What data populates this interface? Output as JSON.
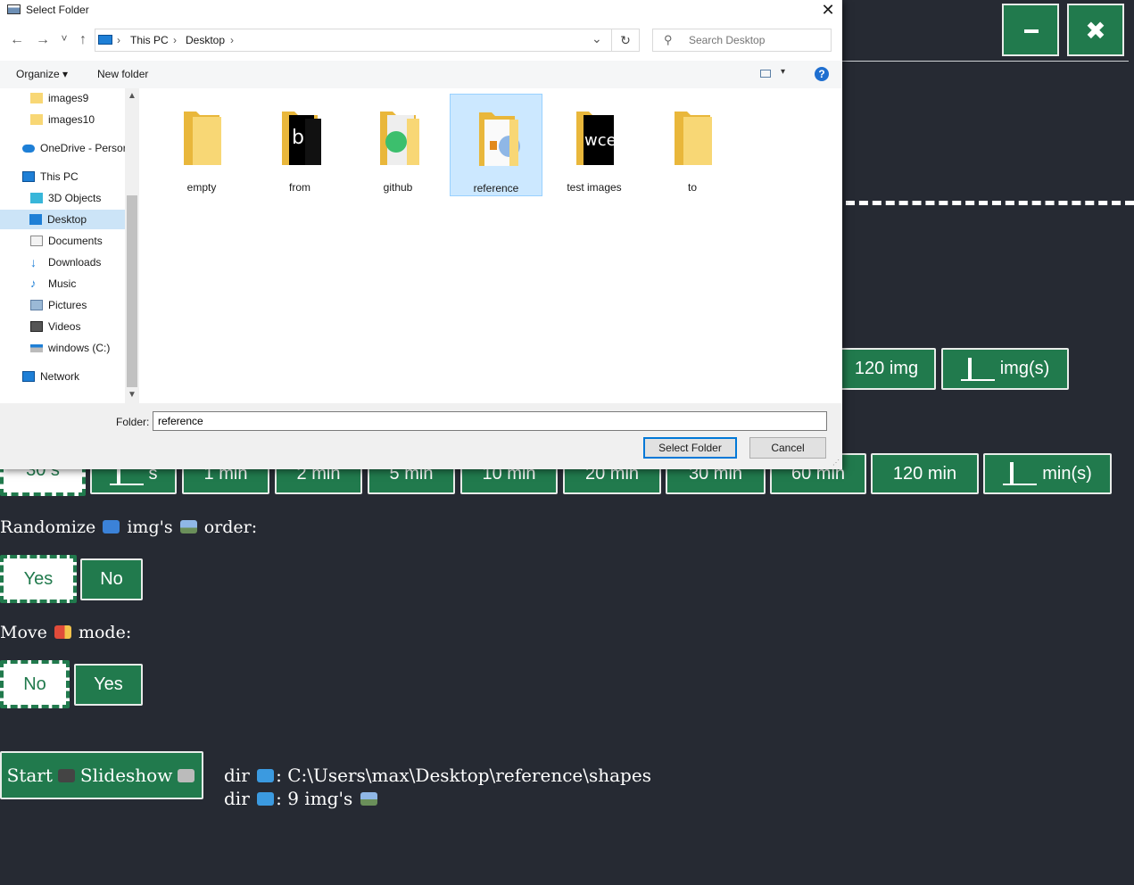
{
  "app": {
    "minimize_label": "−",
    "close_label": "✖",
    "img_count_buttons": [
      "120 img",
      "img(s)"
    ],
    "time_buttons": [
      "30 s",
      "s",
      "1 min",
      "2 min",
      "5 min",
      "10 min",
      "20 min",
      "30 min",
      "60 min",
      "120 min",
      "min(s)"
    ],
    "randomize": {
      "prefix": "Randomize",
      "middle": "img's",
      "suffix": "order:",
      "options": [
        "Yes",
        "No"
      ]
    },
    "move_mode": {
      "prefix": "Move",
      "suffix": "mode:",
      "options": [
        "No",
        "Yes"
      ]
    },
    "start": {
      "prefix": "Start",
      "suffix": "Slideshow"
    },
    "dir_info": {
      "line1_prefix": "dir",
      "line1_value": ": C:\\Users\\max\\Desktop\\reference\\shapes",
      "line2_prefix": "dir",
      "line2_value": ": 9 img's"
    }
  },
  "dialog": {
    "title": "Select Folder",
    "close": "✕",
    "nav": {
      "back": "←",
      "forward": "→",
      "recent": "˅",
      "up": "↑"
    },
    "address": {
      "crumbs": [
        "This PC",
        "Desktop"
      ],
      "sep": "›",
      "dropdown": "⌄",
      "refresh": "↻"
    },
    "search_placeholder": "Search Desktop",
    "search_icon": "⚲",
    "commands": {
      "organize": "Organize ▾",
      "new_folder": "New folder",
      "view_dropdown": "▾",
      "help": "?"
    },
    "nav_pane": [
      {
        "label": "images9",
        "icon": "folder-icon"
      },
      {
        "label": "images10",
        "icon": "folder-icon"
      },
      {
        "label": "OneDrive - Persor",
        "icon": "cloud-icon"
      },
      {
        "label": "This PC",
        "icon": "computer-icon"
      },
      {
        "label": "3D Objects",
        "icon": "cube-icon"
      },
      {
        "label": "Desktop",
        "icon": "desktop-icon"
      },
      {
        "label": "Documents",
        "icon": "document-icon"
      },
      {
        "label": "Downloads",
        "icon": "download-icon"
      },
      {
        "label": "Music",
        "icon": "music-icon"
      },
      {
        "label": "Pictures",
        "icon": "pictures-icon"
      },
      {
        "label": "Videos",
        "icon": "video-icon"
      },
      {
        "label": "windows (C:)",
        "icon": "drive-icon"
      },
      {
        "label": "Network",
        "icon": "network-icon"
      }
    ],
    "files": [
      "empty",
      "from",
      "github",
      "reference",
      "test images",
      "to"
    ],
    "folder_label": "Folder:",
    "folder_value": "reference",
    "select_button": "Select Folder",
    "cancel_button": "Cancel",
    "colors": {
      "accent": "#217a4d",
      "selection": "#cce8ff",
      "folder": "#f8d775"
    }
  }
}
